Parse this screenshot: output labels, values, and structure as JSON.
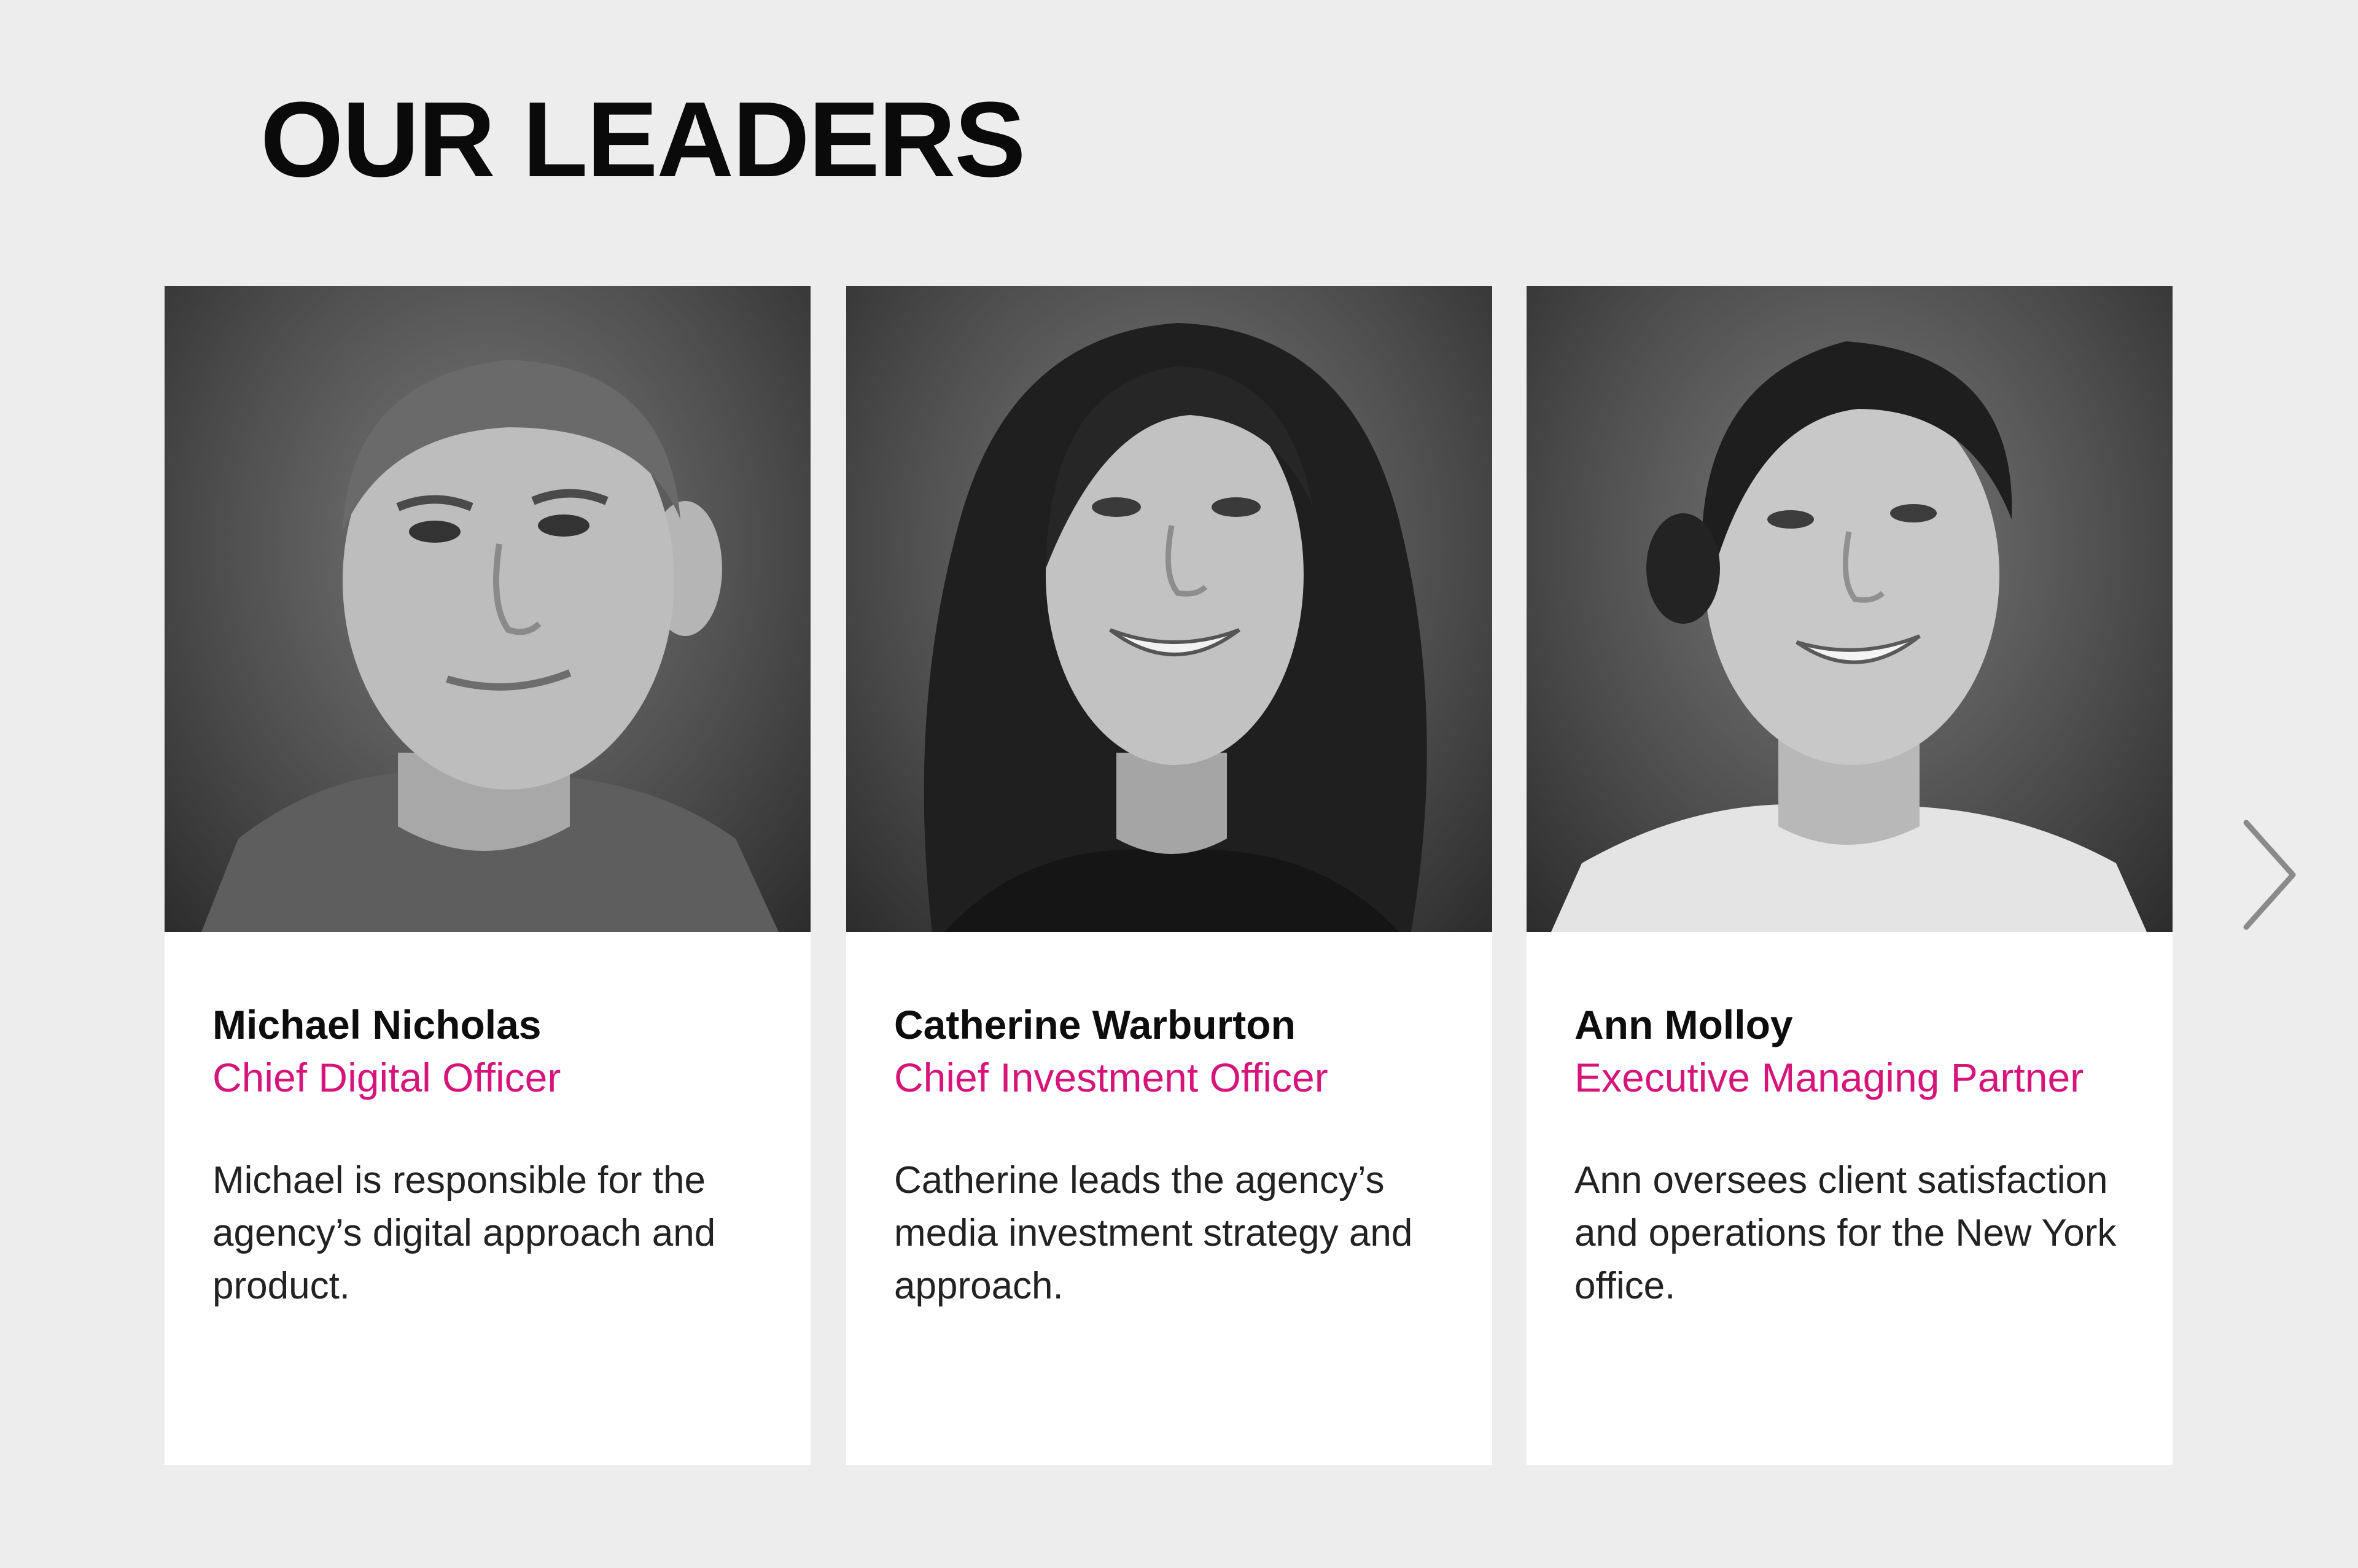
{
  "section": {
    "title": "OUR LEADERS"
  },
  "theme": {
    "accent": "#d6147a",
    "background": "#ededed",
    "card": "#ffffff"
  },
  "leaders": [
    {
      "name": "Michael Nicholas",
      "title": "Chief Digital Officer",
      "bio": "Michael is responsible for the agency’s digital approach and product.",
      "photo": "portrait-michael-nicholas"
    },
    {
      "name": "Catherine Warburton",
      "title": "Chief Investment Officer",
      "bio": "Catherine leads the agency’s media investment strategy and approach.",
      "photo": "portrait-catherine-warburton"
    },
    {
      "name": "Ann Molloy",
      "title": "Executive Managing Partner",
      "bio": "Ann oversees client satisfaction and operations for the New York office.",
      "photo": "portrait-ann-molloy"
    }
  ],
  "carousel": {
    "next_icon": "chevron-right-icon"
  }
}
